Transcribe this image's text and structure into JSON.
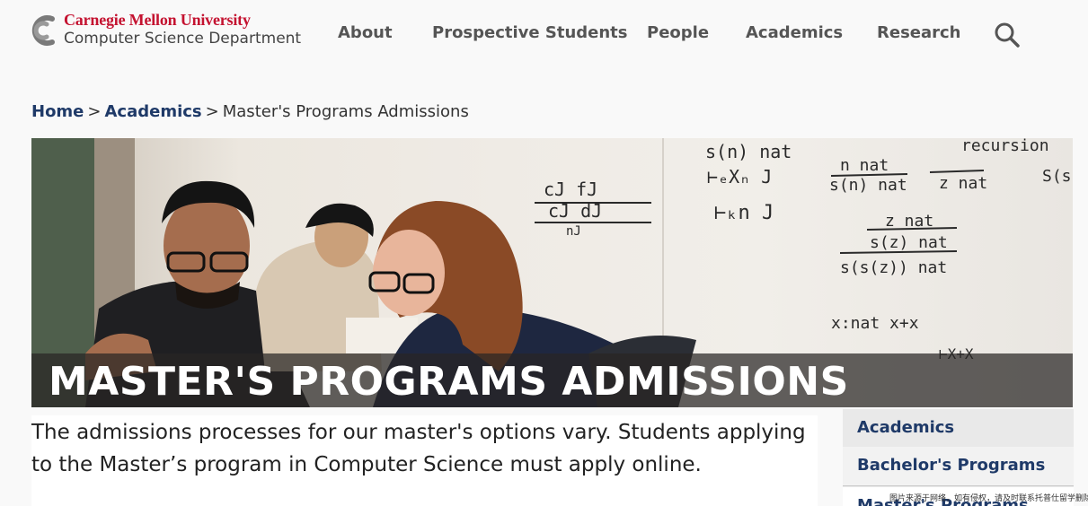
{
  "header": {
    "university": "Carnegie Mellon University",
    "department": "Computer Science Department",
    "nav": [
      "About",
      "Prospective Students",
      "People",
      "Academics",
      "Research"
    ],
    "search_icon": "search-icon",
    "brand_red": "#c41230",
    "nav_color": "#555555"
  },
  "breadcrumb": {
    "home": "Home",
    "sep1": ">",
    "academics": "Academics",
    "sep2": ">",
    "current": "Master's Programs Admissions"
  },
  "hero": {
    "title": "MASTER'S PROGRAMS ADMISSIONS",
    "whiteboard_notes": [
      "recursion",
      "n nat",
      "s(n) nat",
      "z nat",
      "s(z) nat",
      "s(s(z)) nat",
      "x:nat x+x"
    ]
  },
  "intro": {
    "text": "The admissions processes for our master's options vary. Students applying to the Master’s program in Computer Science must apply online."
  },
  "sidebar": {
    "items": [
      "Academics",
      "Bachelor's Programs",
      "Master's Programs"
    ]
  },
  "watermark": "图片来源于网络，如有侵权，请及时联系托普仕留学删除",
  "colors": {
    "link": "#1f3a68",
    "accent": "#c41230"
  }
}
